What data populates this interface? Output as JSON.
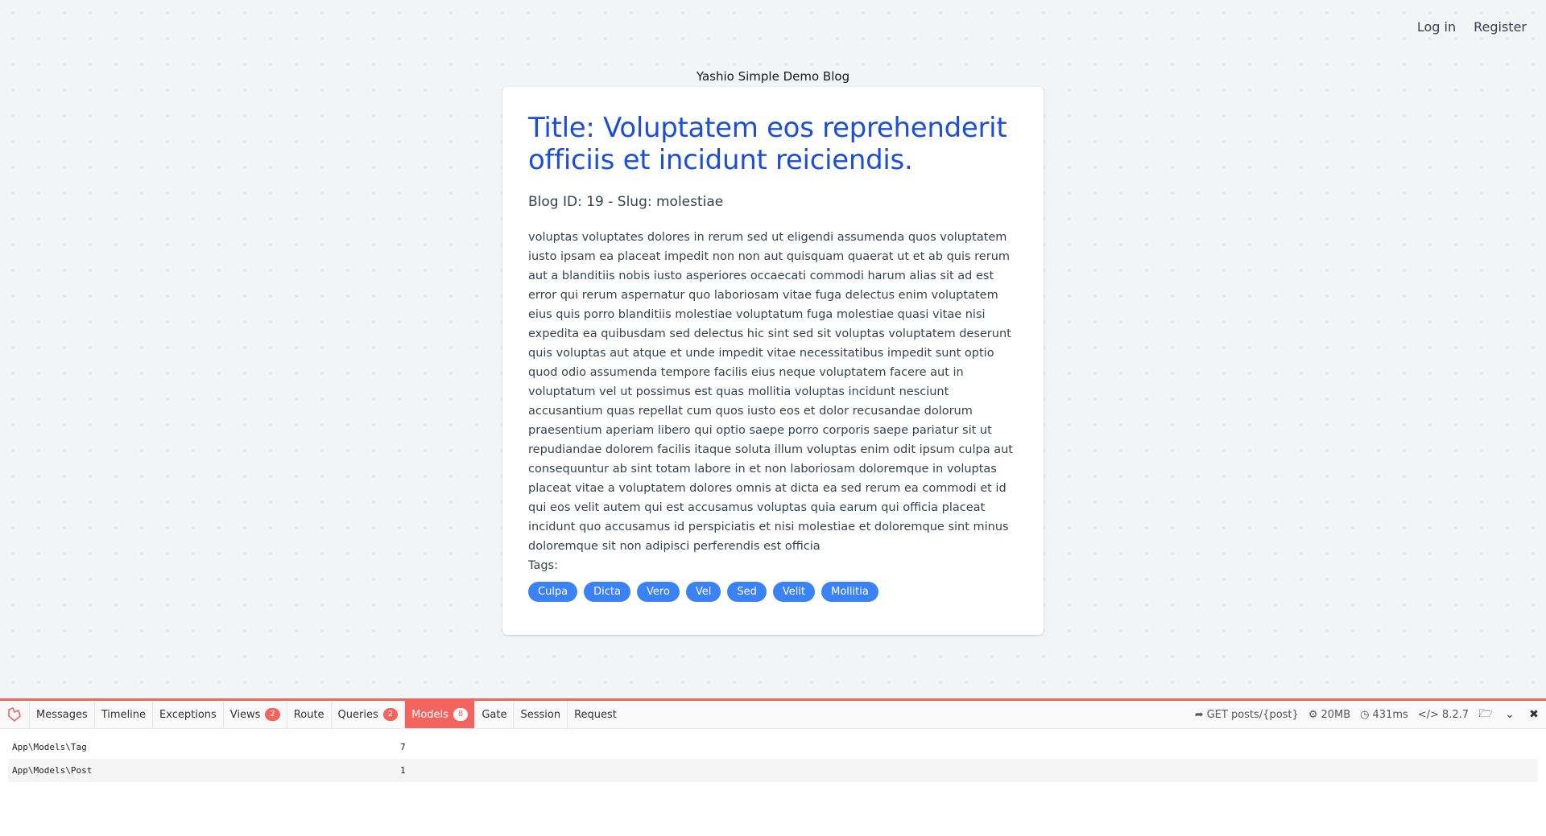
{
  "nav": {
    "login": "Log in",
    "register": "Register"
  },
  "site_title": "Yashio Simple Demo Blog",
  "post": {
    "title": "Title: Voluptatem eos reprehenderit officiis et incidunt reiciendis.",
    "meta": "Blog ID: 19 - Slug: molestiae",
    "body": "voluptas voluptates dolores in rerum sed ut eligendi assumenda quos voluptatem iusto ipsam ea placeat impedit non non aut quisquam quaerat ut et ab quis rerum aut a blanditiis nobis iusto asperiores occaecati commodi harum alias sit ad est error qui rerum aspernatur quo laboriosam vitae fuga delectus enim voluptatem eius quis porro blanditiis molestiae voluptatum fuga molestiae quasi vitae nisi expedita ea quibusdam sed delectus hic sint sed sit voluptas voluptatem deserunt quis voluptas aut atque et unde impedit vitae necessitatibus impedit sunt optio quod odio assumenda tempore facilis eius neque voluptatem facere aut in voluptatum vel ut possimus est quas mollitia voluptas incidunt nesciunt accusantium quas repellat cum quos iusto eos et dolor recusandae dolorum praesentium aperiam libero qui optio saepe porro corporis saepe pariatur sit ut repudiandae dolorem facilis itaque soluta illum voluptas enim odit ipsum culpa aut consequuntur ab sint totam labore in et non laboriosam doloremque in voluptas placeat vitae a voluptatem dolores omnis at dicta ea sed rerum ea commodi et id qui eos velit autem qui est accusamus voluptas quia earum qui officia placeat incidunt quo accusamus id perspiciatis et nisi molestiae et doloremque sint minus doloremque sit non adipisci perferendis est officia",
    "tags_label": "Tags:",
    "tags": [
      "Culpa",
      "Dicta",
      "Vero",
      "Vel",
      "Sed",
      "Velit",
      "Mollitia"
    ]
  },
  "debugbar": {
    "tabs": [
      {
        "label": "Messages"
      },
      {
        "label": "Timeline"
      },
      {
        "label": "Exceptions"
      },
      {
        "label": "Views",
        "badge": "2"
      },
      {
        "label": "Route"
      },
      {
        "label": "Queries",
        "badge": "2"
      },
      {
        "label": "Models",
        "badge": "8",
        "active": true
      },
      {
        "label": "Gate"
      },
      {
        "label": "Session"
      },
      {
        "label": "Request"
      }
    ],
    "request": "GET posts/{post}",
    "memory": "20MB",
    "time": "431ms",
    "php_version": "8.2.7",
    "models": [
      {
        "name": "App\\Models\\Tag",
        "count": "7"
      },
      {
        "name": "App\\Models\\Post",
        "count": "1"
      }
    ],
    "accent": "#f4645f"
  }
}
